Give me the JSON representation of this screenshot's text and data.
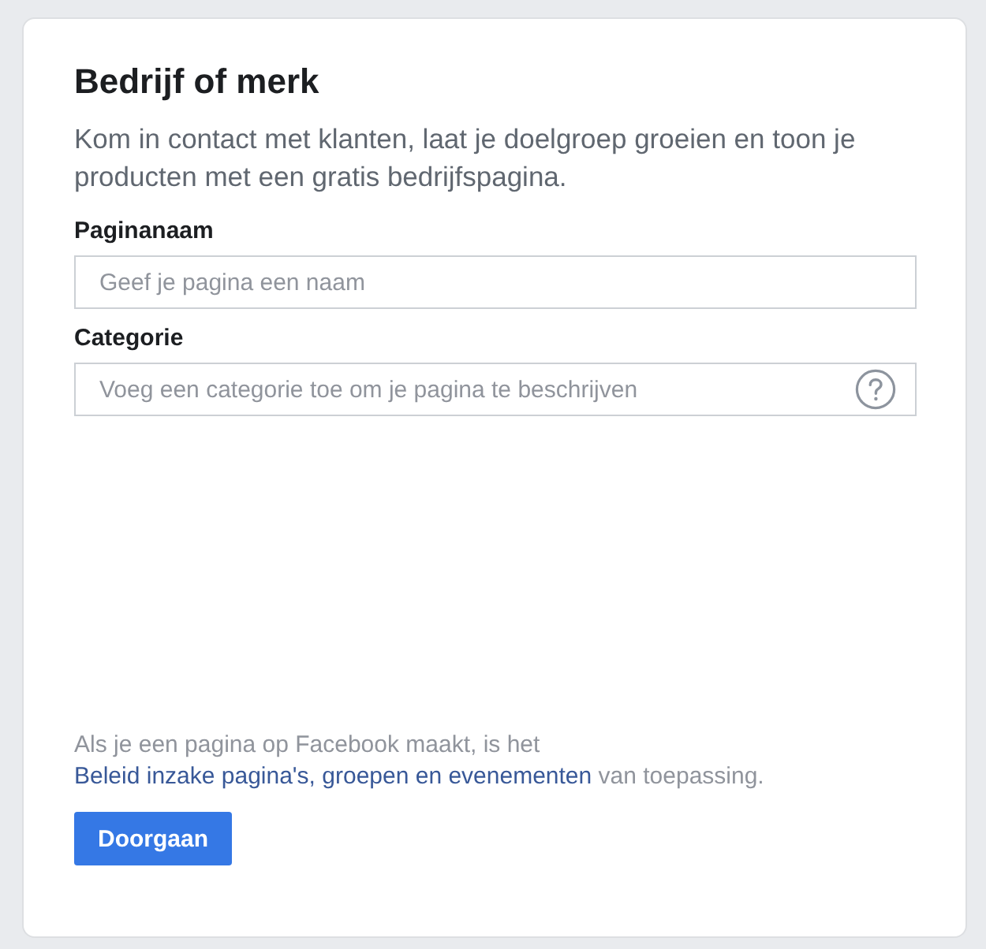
{
  "card": {
    "title": "Bedrijf of merk",
    "description": "Kom in contact met klanten, laat je doelgroep groeien en toon je producten met een gratis bedrijfspagina.",
    "fields": [
      {
        "label": "Paginanaam",
        "placeholder": "Geef je pagina een naam",
        "kind": "text"
      },
      {
        "label": "Categorie",
        "placeholder": "Voeg een categorie toe om je pagina te beschrijven",
        "kind": "help"
      }
    ],
    "notice": [
      {
        "text": "Als je een pagina op Facebook maakt, is het ",
        "kind": "text"
      },
      {
        "text": "Beleid inzake pagina's, groepen en evenementen",
        "kind": "link"
      },
      {
        "text": " van toepassing.",
        "kind": "text"
      }
    ],
    "button": "Doorgaan"
  }
}
